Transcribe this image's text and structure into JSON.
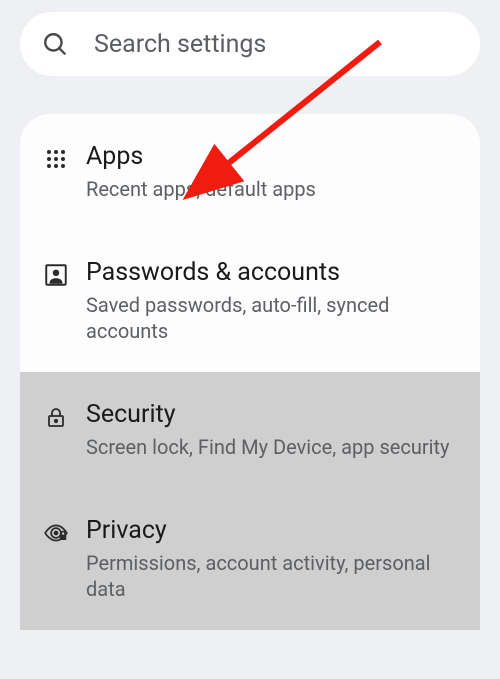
{
  "search": {
    "placeholder": "Search settings"
  },
  "settings": {
    "items": [
      {
        "title": "Apps",
        "subtitle": "Recent apps, default apps"
      },
      {
        "title": "Passwords & accounts",
        "subtitle": "Saved passwords, auto-fill, synced accounts"
      },
      {
        "title": "Security",
        "subtitle": "Screen lock, Find My Device, app security"
      },
      {
        "title": "Privacy",
        "subtitle": "Permissions, account activity, personal data"
      }
    ]
  },
  "annotation": {
    "arrow_color": "#ef1c0f"
  }
}
